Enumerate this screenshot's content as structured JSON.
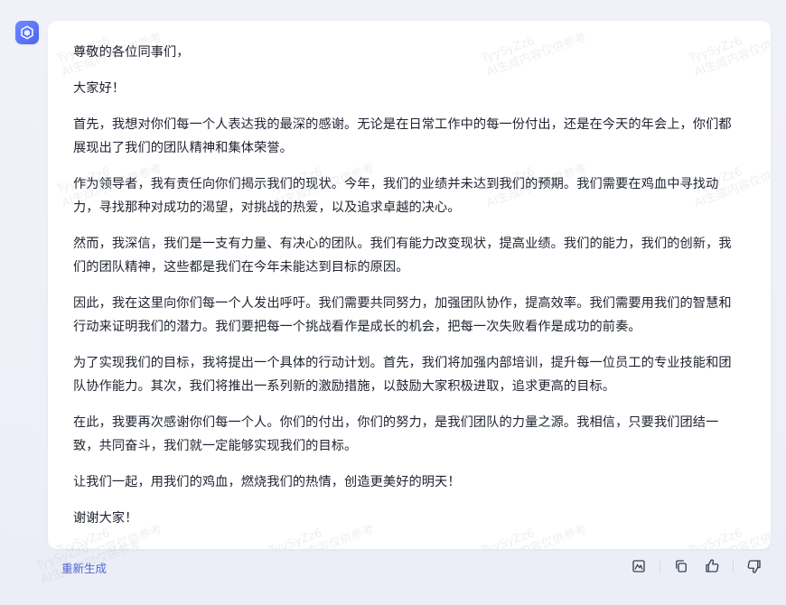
{
  "message": {
    "paragraphs": [
      "尊敬的各位同事们，",
      "大家好！",
      "首先，我想对你们每一个人表达我的最深的感谢。无论是在日常工作中的每一份付出，还是在今天的年会上，你们都展现出了我们的团队精神和集体荣誉。",
      "作为领导者，我有责任向你们揭示我们的现状。今年，我们的业绩并未达到我们的预期。我们需要在鸡血中寻找动力，寻找那种对成功的渴望，对挑战的热爱，以及追求卓越的决心。",
      "然而，我深信，我们是一支有力量、有决心的团队。我们有能力改变现状，提高业绩。我们的能力，我们的创新，我们的团队精神，这些都是我们在今年未能达到目标的原因。",
      "因此，我在这里向你们每一个人发出呼吁。我们需要共同努力，加强团队协作，提高效率。我们需要用我们的智慧和行动来证明我们的潜力。我们要把每一个挑战看作是成长的机会，把每一次失败看作是成功的前奏。",
      "为了实现我们的目标，我将提出一个具体的行动计划。首先，我们将加强内部培训，提升每一位员工的专业技能和团队协作能力。其次，我们将推出一系列新的激励措施，以鼓励大家积极进取，追求更高的目标。",
      "在此，我要再次感谢你们每一个人。你们的付出，你们的努力，是我们团队的力量之源。我相信，只要我们团结一致，共同奋斗，我们就一定能够实现我们的目标。",
      "让我们一起，用我们的鸡血，燃烧我们的热情，创造更美好的明天！",
      "谢谢大家！"
    ]
  },
  "watermark": {
    "line1": "TyySyZz6",
    "line2": "AI生成内容仅供参考"
  },
  "footer": {
    "regenerate_label": "重新生成"
  },
  "icons": {
    "avatar": "assistant-logo-icon",
    "gallery": "image-icon",
    "copy": "copy-icon",
    "like": "thumbs-up-icon",
    "dislike": "thumbs-down-icon"
  },
  "colors": {
    "accent": "#4e63d8",
    "background": "#eceef7",
    "card": "#ffffff",
    "text": "#1f2330"
  }
}
